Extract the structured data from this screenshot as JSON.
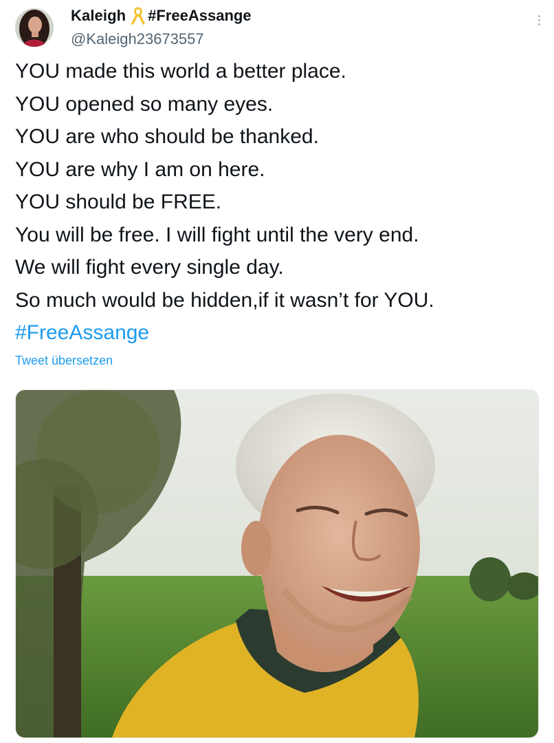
{
  "author": {
    "display_name": "Kaleigh",
    "display_tag": "#FreeAssange",
    "handle": "@Kaleigh23673557",
    "avatar_icon": "profile-photo",
    "badge_icon": "yellow-ribbon-icon"
  },
  "tweet": {
    "lines": [
      "YOU made this world a better place.",
      "YOU opened so many eyes.",
      "YOU are who should be thanked.",
      "YOU are why I am on here.",
      "YOU should be FREE.",
      "You will be free. I will fight until the very end.",
      "We will fight every single day.",
      "So much would be hidden,if it wasn’t for YOU."
    ],
    "hashtag": "#FreeAssange",
    "translate_label": "Tweet übersetzen"
  },
  "media": {
    "description_icon": "photo"
  },
  "colors": {
    "link": "#1d9bf0",
    "text": "#0f1419",
    "secondary": "#536471"
  }
}
